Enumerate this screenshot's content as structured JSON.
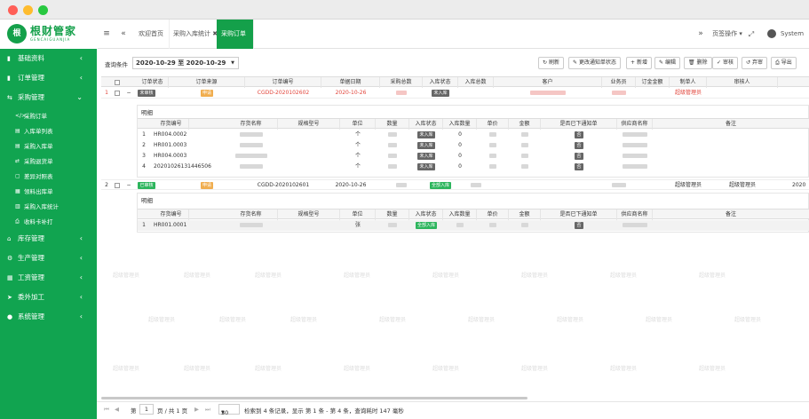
{
  "window": {
    "colors": {
      "close": "#ff5f57",
      "min": "#febc2e",
      "max": "#28c840"
    }
  },
  "header": {
    "logo_mark": "根",
    "logo_name": "根财管家",
    "logo_sub": "GENCAIGUANJIA",
    "tabs": [
      {
        "label": "欢迎首页"
      },
      {
        "label": "采购入库统计 ✖"
      },
      {
        "label": "采购订单 ✖",
        "active": true
      }
    ],
    "page_ops": "页签操作 ▾",
    "user": "System"
  },
  "sidebar": {
    "items": [
      {
        "label": "基础资料",
        "icon": "▪"
      },
      {
        "label": "订单管理",
        "icon": "▪"
      },
      {
        "label": "采购管理",
        "icon": "▪",
        "expanded": true
      },
      {
        "label": "库存管理",
        "icon": "▪"
      },
      {
        "label": "生产管理",
        "icon": "▪"
      },
      {
        "label": "工资管理",
        "icon": "▪"
      },
      {
        "label": "委外加工",
        "icon": "▪"
      },
      {
        "label": "系统管理",
        "icon": "▪"
      }
    ],
    "sub_items": [
      {
        "label": "采购订单",
        "icon": "</>"
      },
      {
        "label": "入库单列表",
        "icon": "▤"
      },
      {
        "label": "采购入库单",
        "icon": "▤"
      },
      {
        "label": "采购退货单",
        "icon": "⇄"
      },
      {
        "label": "差异对照表",
        "icon": "▢"
      },
      {
        "label": "领料出库单",
        "icon": "▦"
      },
      {
        "label": "采购入库统计",
        "icon": "▥"
      },
      {
        "label": "收料卡补打",
        "icon": "⎙"
      }
    ]
  },
  "toolbar": {
    "query_label": "查询条件",
    "date_range": "2020-10-29 至 2020-10-29",
    "buttons": [
      "刷新",
      "更改通知单状态",
      "新增",
      "编辑",
      "删除",
      "审核",
      "弃审",
      "导出"
    ]
  },
  "grid": {
    "headers": [
      "订单状态",
      "订单来源",
      "订单编号",
      "单据日期",
      "采购总数",
      "入库状态",
      "入库总数",
      "客户",
      "业务员",
      "订金金额",
      "制单人",
      "审核人",
      ""
    ],
    "rows": [
      {
        "index": "1",
        "expand": "−",
        "status": "未审核",
        "source": "申请",
        "order_no": "CGDD-2020102602",
        "date": "2020-10-26",
        "stock_status": "未入库",
        "maker": "超级管理员",
        "auditor": "",
        "trail": ""
      },
      {
        "index": "2",
        "expand": "−",
        "status": "已审核",
        "source": "申请",
        "order_no": "CGDD-2020102601",
        "date": "2020-10-26",
        "stock_status": "全部入库",
        "maker": "超级管理员",
        "auditor": "超级管理员",
        "trail": "2020"
      }
    ],
    "detail_title": "明细",
    "detail_headers": [
      "存货编号",
      "存货名称",
      "规格型号",
      "单位",
      "数量",
      "入库状态",
      "入库数量",
      "单价",
      "金额",
      "是否已下通知单",
      "供应商名称",
      "备注"
    ],
    "detail1": [
      {
        "i": "1",
        "code": "HR004.0002",
        "unit": "个",
        "stock": "未入库",
        "qty_in": "0",
        "notice": "否"
      },
      {
        "i": "2",
        "code": "HR001.0003",
        "unit": "个",
        "stock": "未入库",
        "qty_in": "0",
        "notice": "否"
      },
      {
        "i": "3",
        "code": "HR004.0003",
        "unit": "个",
        "stock": "未入库",
        "qty_in": "0",
        "notice": "否"
      },
      {
        "i": "4",
        "code": "20201026131446506",
        "unit": "个",
        "stock": "未入库",
        "qty_in": "0",
        "notice": "否"
      }
    ],
    "detail2": [
      {
        "i": "1",
        "code": "HR001.0001",
        "unit": "张",
        "stock": "全部入库",
        "qty_in": "",
        "notice": "否"
      }
    ]
  },
  "watermark": "超级管理员",
  "footer": {
    "page_label": "第",
    "page_value": "1",
    "page_total": "页 / 共 1 页",
    "page_size": "30",
    "summary": "检索到 4 条记录，显示 第 1 条 - 第 4 条，查询耗时 147 毫秒"
  }
}
